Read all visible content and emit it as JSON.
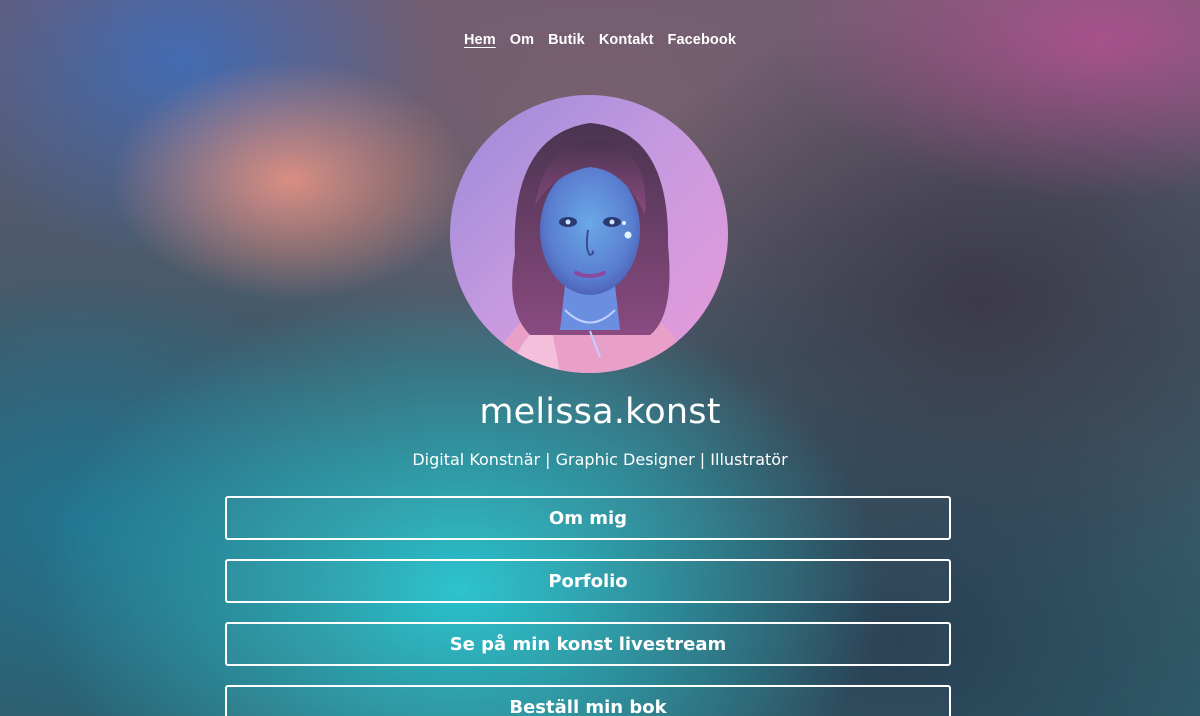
{
  "nav": {
    "items": [
      {
        "label": "Hem",
        "active": true
      },
      {
        "label": "Om",
        "active": false
      },
      {
        "label": "Butik",
        "active": false
      },
      {
        "label": "Kontakt",
        "active": false
      },
      {
        "label": "Facebook",
        "active": false
      }
    ]
  },
  "profile": {
    "name": "melissa.konst",
    "tagline": "Digital Konstnär | Graphic Designer | Illustratör"
  },
  "links": [
    {
      "label": "Om mig"
    },
    {
      "label": "Porfolio"
    },
    {
      "label": "Se på min konst livestream"
    },
    {
      "label": "Beställ min bok"
    }
  ],
  "colors": {
    "text": "#ffffff",
    "button_border": "#ffffff"
  }
}
